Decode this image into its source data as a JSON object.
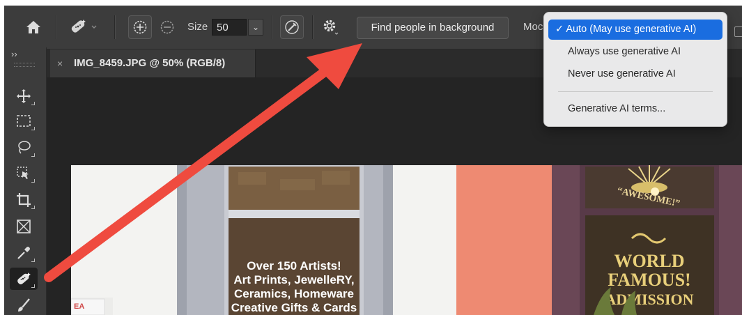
{
  "options_bar": {
    "home_icon": "home-icon",
    "tool_icon": "spot-healing-bandage-icon",
    "add_icon": "circle-plus-icon",
    "subtract_icon": "circle-minus-icon",
    "size_label": "Size",
    "size_value": "50",
    "find_button": "Find people in background",
    "mode_label": "Moc"
  },
  "document_tab": {
    "close": "×",
    "title": "IMG_8459.JPG @ 50% (RGB/8)"
  },
  "toolbar": {
    "expand": "››",
    "tools": [
      "move",
      "marquee",
      "lasso",
      "object-select",
      "crop",
      "frame",
      "eyedropper",
      "spot-healing",
      "brush"
    ]
  },
  "mode_menu": {
    "items": [
      {
        "label": "Auto (May use generative AI)",
        "checked": true
      },
      {
        "label": "Always use generative AI",
        "checked": false
      },
      {
        "label": "Never use generative AI",
        "checked": false
      },
      {
        "label": "Generative AI terms...",
        "checked": false
      }
    ],
    "check_mark": "✓"
  },
  "photo": {
    "window_left_text": [
      "Over 150 Artists!",
      "Art Prints, JewelleRY,",
      "Ceramics,  Homeware",
      "Creative Gifts & Cards"
    ],
    "sign_top": "“AWESOME!”",
    "sign_main": [
      "WORLD",
      "FAMOUS!",
      "ADMISSION"
    ],
    "small_sign": "EA"
  },
  "colors": {
    "accent": "#1a6de0",
    "annotation_arrow": "#ef4b3f",
    "storefront_coral": "#ee8a72",
    "storefront_purple": "#6a4756"
  }
}
